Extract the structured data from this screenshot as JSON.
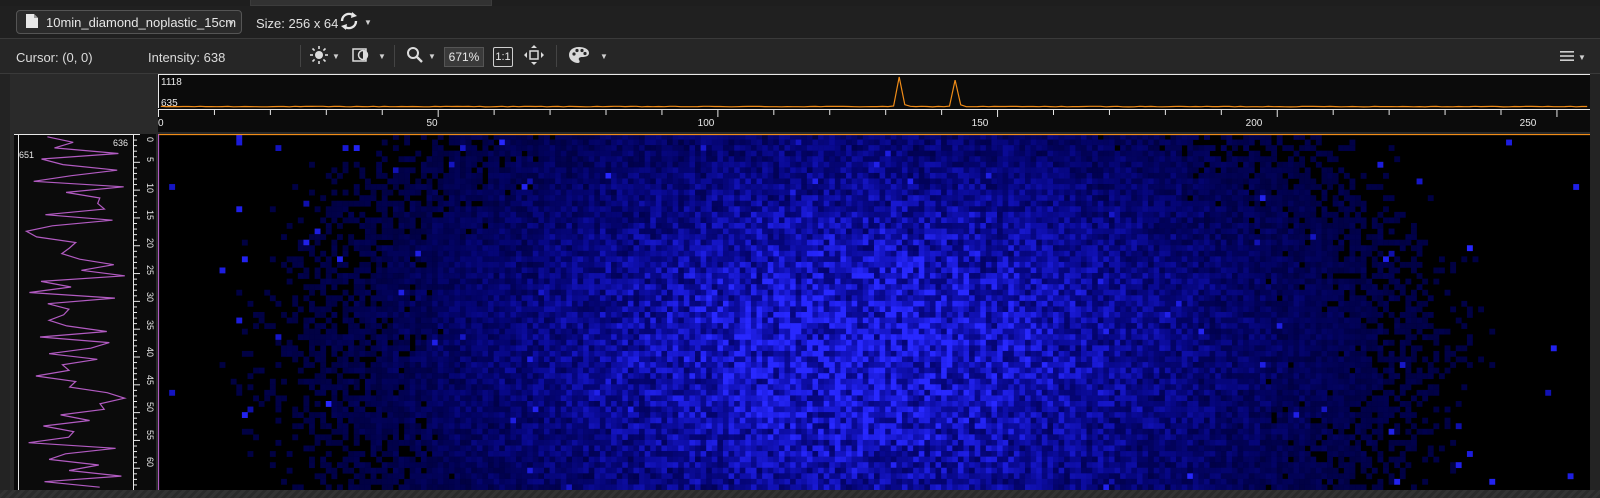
{
  "file": {
    "name": "10min_diamond_noplastic_15cm",
    "icon": "file-icon"
  },
  "size_label": "Size: 256 x 64",
  "cursor_label": "Cursor: (0, 0)",
  "intensity_label": "Intensity: 638",
  "zoom": "671%",
  "one_to_one": "1:1",
  "icons": [
    "file-icon",
    "refresh-icon",
    "brightness-icon",
    "contrast-icon",
    "zoom-icon",
    "fit-icon",
    "palette-icon",
    "menu-icon"
  ],
  "colors": {
    "horizontal_profile": "#f08c18",
    "vertical_profile": "#b25bc2",
    "image_pixels": "#1428ff",
    "background": "#000000"
  },
  "horizontal_profile": {
    "max_label": "1118",
    "min_label": "635",
    "x_ticks": [
      "0",
      "50",
      "100",
      "150",
      "200",
      "250"
    ],
    "x_max": 256,
    "peaks": [
      {
        "x": 132,
        "value": 1118
      },
      {
        "x": 142,
        "value": 1068
      }
    ]
  },
  "vertical_profile": {
    "top_label": "636",
    "left_label": "651",
    "y_ticks": [
      "0",
      "5",
      "10",
      "15",
      "20",
      "25",
      "30",
      "35",
      "40",
      "45",
      "50",
      "55",
      "60"
    ],
    "y_max": 64
  },
  "image": {
    "width": 256,
    "height": 64,
    "cursor": [
      0,
      0
    ]
  }
}
